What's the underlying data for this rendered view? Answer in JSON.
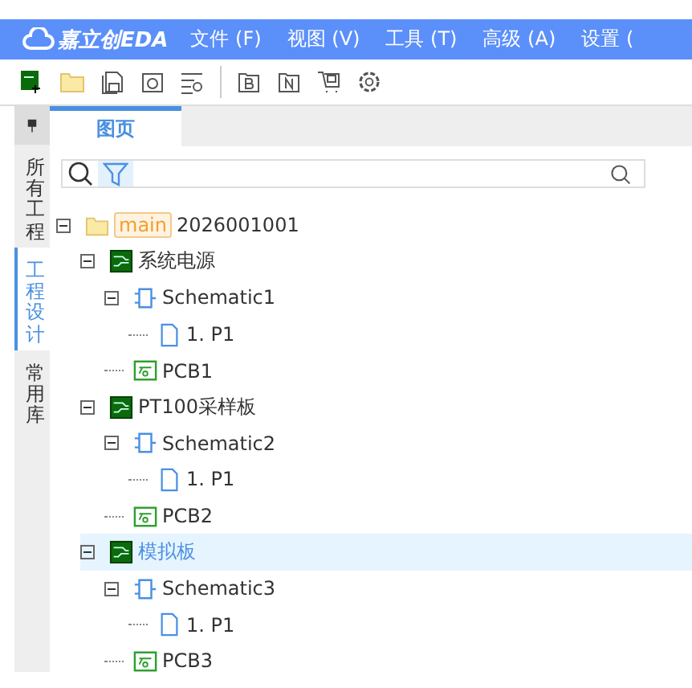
{
  "menu_bar": {
    "logo": "嘉立创EDA",
    "items": [
      "文件 (F)",
      "视图 (V)",
      "工具 (T)",
      "高级 (A)",
      "设置 ("
    ]
  },
  "side_tabs": [
    {
      "label": "所有工程",
      "selected": false
    },
    {
      "label": "工程设计",
      "selected": true
    },
    {
      "label": "常用库",
      "selected": false
    }
  ],
  "tabs": [
    {
      "label": "图页",
      "selected": true
    }
  ],
  "tree": [
    {
      "kind": "project",
      "tag": "main",
      "label": "2026001001",
      "expanded": true,
      "selected": false,
      "children": [
        {
          "kind": "board",
          "label": "系统电源",
          "expanded": true,
          "selected": false,
          "children": [
            {
              "kind": "schematic",
              "label": "Schematic1",
              "expanded": true,
              "selected": false,
              "children": [
                {
                  "kind": "page",
                  "label": "1. P1",
                  "selected": false
                }
              ]
            },
            {
              "kind": "pcb",
              "label": "PCB1",
              "selected": false
            }
          ]
        },
        {
          "kind": "board",
          "label": "PT100采样板",
          "expanded": true,
          "selected": false,
          "children": [
            {
              "kind": "schematic",
              "label": "Schematic2",
              "expanded": true,
              "selected": false,
              "children": [
                {
                  "kind": "page",
                  "label": "1. P1",
                  "selected": false
                }
              ]
            },
            {
              "kind": "pcb",
              "label": "PCB2",
              "selected": false
            }
          ]
        },
        {
          "kind": "board",
          "label": "模拟板",
          "expanded": true,
          "selected": true,
          "children": [
            {
              "kind": "schematic",
              "label": "Schematic3",
              "expanded": true,
              "selected": false,
              "children": [
                {
                  "kind": "page",
                  "label": "1. P1",
                  "selected": false
                }
              ]
            },
            {
              "kind": "pcb",
              "label": "PCB3",
              "selected": false
            }
          ]
        }
      ]
    }
  ]
}
